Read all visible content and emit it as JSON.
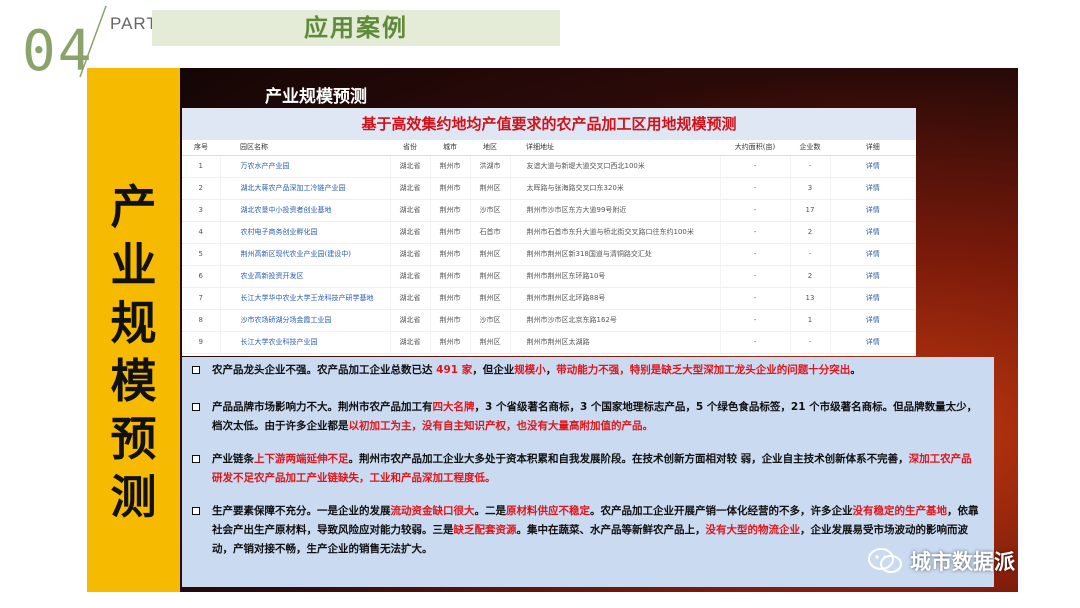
{
  "header": {
    "part_num": "04",
    "part_label": "PART",
    "title": "应用案例"
  },
  "sidebar": {
    "chars": [
      "产",
      "业",
      "规",
      "模",
      "预",
      "测"
    ]
  },
  "panel": {
    "title": "产业规模预测"
  },
  "table": {
    "caption": "基于高效集约地均产值要求的农产品加工区用地规模预测",
    "columns": [
      "序号",
      "园区名称",
      "省份",
      "城市",
      "地区",
      "详细地址",
      "大约面积(亩)",
      "企业数",
      "详细"
    ],
    "rows": [
      [
        "1",
        "万农水产产业园",
        "湖北省",
        "荆州市",
        "洪湖市",
        "友谊大道与新堤大道交叉口西北100米",
        "-",
        "-",
        "详情"
      ],
      [
        "2",
        "湖北大蒋农产品深加工冷链产业园",
        "湖北省",
        "荆州市",
        "荆州区",
        "太晖路与张海路交叉口东320米",
        "-",
        "3",
        "详情"
      ],
      [
        "3",
        "湖北农垦中小投资者创业基地",
        "湖北省",
        "荆州市",
        "沙市区",
        "荆州市沙市区东方大道99号附近",
        "-",
        "17",
        "详情"
      ],
      [
        "4",
        "农村电子商务创业孵化园",
        "湖北省",
        "荆州市",
        "石首市",
        "荆州市石首市东升大道与桥北街交叉路口往东约100米",
        "-",
        "2",
        "详情"
      ],
      [
        "5",
        "荆州高新区现代农业产业园(建设中)",
        "湖北省",
        "荆州市",
        "荆州区",
        "荆州市荆州区新318国道与清铜路交汇处",
        "-",
        "-",
        "详情"
      ],
      [
        "6",
        "农业高新投资开发区",
        "湖北省",
        "荆州市",
        "荆州区",
        "荆州市荆州区东环路10号",
        "-",
        "2",
        "详情"
      ],
      [
        "7",
        "长江大学华中农业大学王龙科技产研学基地",
        "湖北省",
        "荆州市",
        "荆州区",
        "荆州市荆州区北环路88号",
        "-",
        "13",
        "详情"
      ],
      [
        "8",
        "沙市农场硚湖分场金霞工业园",
        "湖北省",
        "荆州市",
        "沙市区",
        "荆州市沙市区北京东路162号",
        "-",
        "1",
        "详情"
      ],
      [
        "9",
        "长江大学农业科技产业园",
        "湖北省",
        "荆州市",
        "荆州区",
        "荆州市荆州区太湖路",
        "-",
        "-",
        "详情"
      ]
    ]
  },
  "notes": [
    {
      "parts": [
        {
          "t": "农产品龙头企业不强。农产品加工企业总数已达 ",
          "r": false
        },
        {
          "t": "491 家",
          "r": true
        },
        {
          "t": "，但企业",
          "r": false
        },
        {
          "t": "规模小",
          "r": true
        },
        {
          "t": "，",
          "r": false
        },
        {
          "t": "带动能力不强，特别是缺乏大型深加工龙头企业的问题十分突出",
          "r": true
        },
        {
          "t": "。",
          "r": false
        }
      ]
    },
    {
      "parts": [
        {
          "t": "产品品牌市场影响力不大。荆州市农产品加工有",
          "r": false
        },
        {
          "t": "四大名牌",
          "r": true
        },
        {
          "t": "，3 个省级著名商标，3 个国家地理标志产品，5 个绿色食品标签，21 个市级著名商标。但品牌数量太少，档次太低。由于许多企业都是",
          "r": false
        },
        {
          "t": "以初加工为主，没有自主知识产权，也没有大量高附加值的产品。",
          "r": true
        }
      ]
    },
    {
      "parts": [
        {
          "t": "产业链条",
          "r": false
        },
        {
          "t": "上下游两端延伸不足",
          "r": true
        },
        {
          "t": "。荆州市农产品加工企业大多处于资本积累和自我发展阶段。在技术创新方面相对较 弱，企业自主技术创新体系不完善，",
          "r": false
        },
        {
          "t": "深加工农产品研发不足农产品加工产业链缺失，工业和产品深加工程度低。",
          "r": true
        }
      ]
    },
    {
      "parts": [
        {
          "t": "生产要素保障不充分。一是企业的发展",
          "r": false
        },
        {
          "t": "流动资金缺口很大",
          "r": true
        },
        {
          "t": "。二是",
          "r": false
        },
        {
          "t": "原材料供应不稳定",
          "r": true
        },
        {
          "t": "。农产品加工企业开展产销一体化经营的不多，许多企业",
          "r": false
        },
        {
          "t": "没有稳定的生产基地",
          "r": true
        },
        {
          "t": "，依靠社会产出生产原材料，导致风险应对能力较弱。三是",
          "r": false
        },
        {
          "t": "缺乏配套资源",
          "r": true
        },
        {
          "t": "。集中在蔬菜、水产品等新鲜农产品上，",
          "r": false
        },
        {
          "t": "没有大型的物流企业",
          "r": true
        },
        {
          "t": "，企业发展易受市场波动的影响而波动，产销对接不畅，生产企业的销售无法扩大。",
          "r": false
        }
      ]
    }
  ],
  "watermark": {
    "text": "城市数据派",
    "icon": "wechat-icon"
  },
  "colors": {
    "accent_yellow": "#f6bb00",
    "header_green": "#5f8a3a",
    "highlight_red": "#e0161c",
    "note_bg": "#c9daf1"
  }
}
